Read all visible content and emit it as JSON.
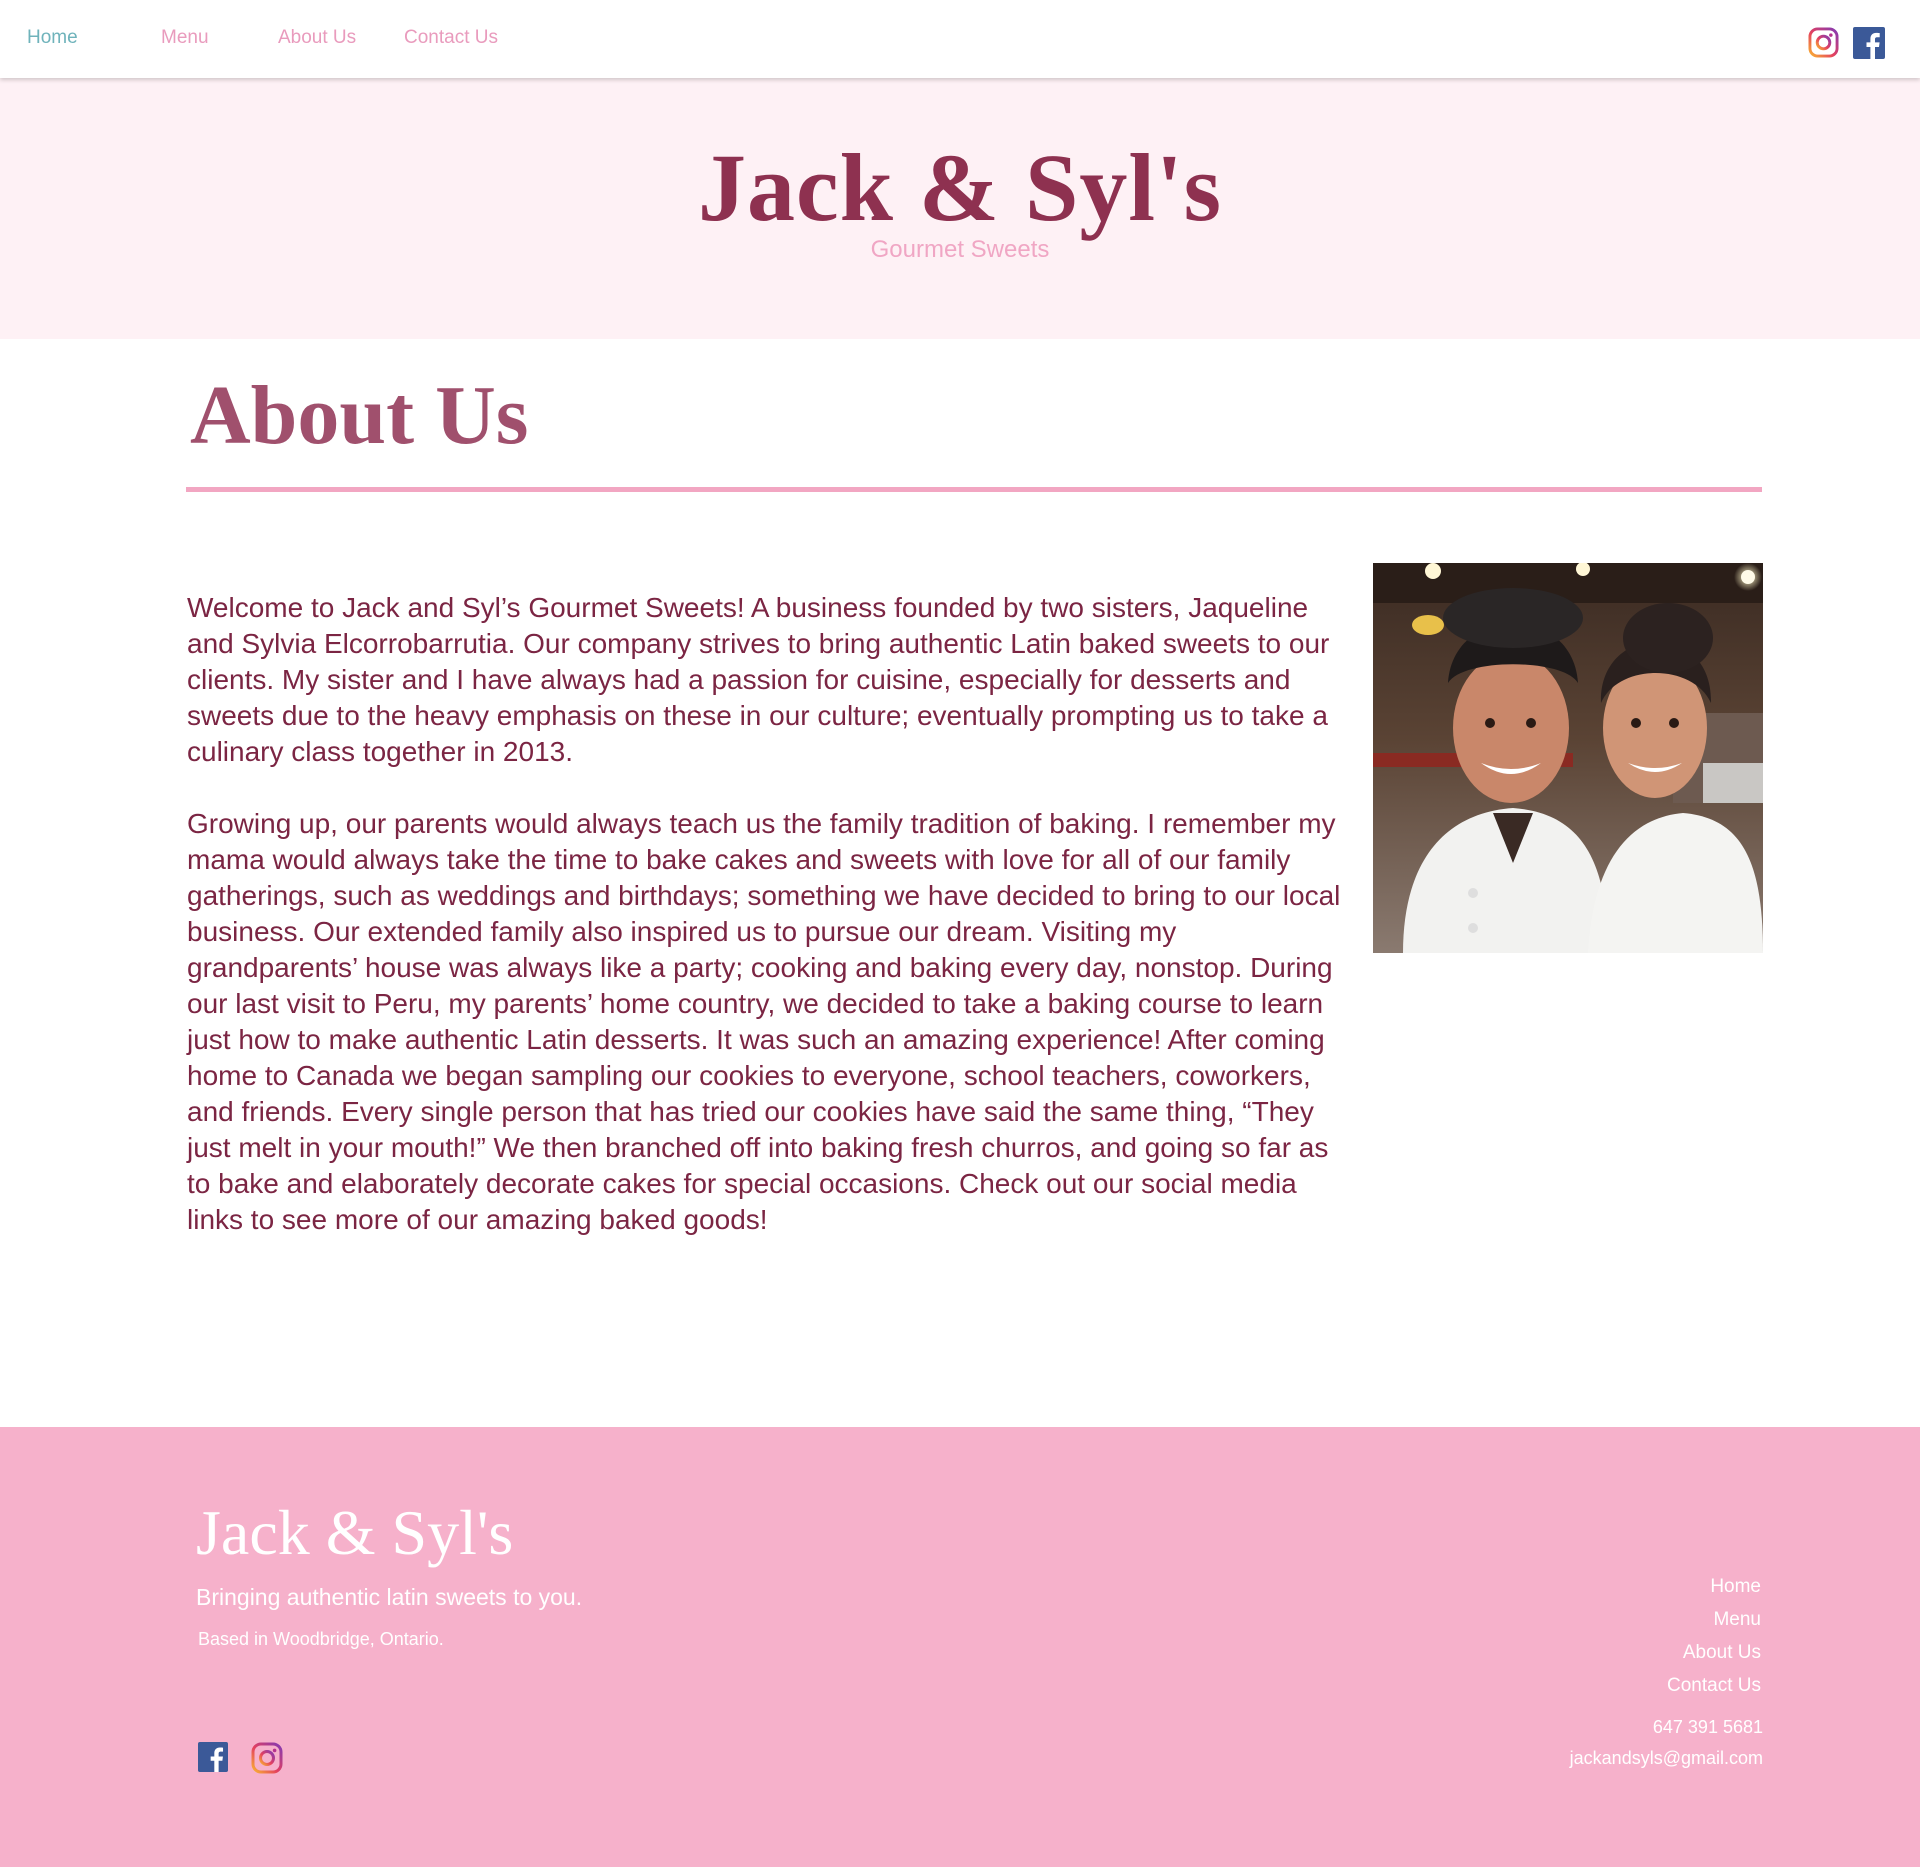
{
  "nav": {
    "items": [
      {
        "label": "Home"
      },
      {
        "label": "Menu"
      },
      {
        "label": "About Us"
      },
      {
        "label": "Contact Us"
      }
    ],
    "social": [
      "instagram-icon",
      "facebook-icon"
    ]
  },
  "hero": {
    "title": "Jack & Syl's",
    "subtitle": "Gourmet Sweets"
  },
  "about": {
    "heading": "About Us",
    "paragraphs": [
      "Welcome to Jack and Syl’s Gourmet Sweets! A business founded by two sisters, Jaqueline and Sylvia Elcorrobarrutia. Our company strives to bring authentic Latin baked sweets to our clients. My sister and I have always had a passion for cuisine, especially for desserts and sweets due to the heavy emphasis on these in our culture; eventually prompting us to take a culinary class together in 2013.",
      "Growing up, our parents would always teach us the family tradition of baking. I remember my mama would always take the time to bake cakes and sweets with love for all of our family gatherings, such as weddings and birthdays; something we have decided to bring to our local business. Our extended family also inspired us to pursue our dream. Visiting my grandparents’ house was always like a party; cooking and baking every day, nonstop. During our last visit to Peru, my parents’ home country, we decided to take a baking course to learn just how to make authentic Latin desserts. It was such an amazing experience! After coming home to Canada we began sampling our cookies to everyone, school teachers, coworkers, and friends. Every single person that has tried our cookies have said the same thing, “They just melt in your mouth!” We then branched off into baking fresh churros, and going so far as to bake and elaborately decorate cakes for special occasions. Check out our social media links to see more of our amazing baked goods!"
    ]
  },
  "footer": {
    "brand": "Jack & Syl's",
    "tagline": "Bringing authentic latin sweets to you.",
    "location": "Based in Woodbridge, Ontario.",
    "links": [
      {
        "label": "Home"
      },
      {
        "label": "Menu"
      },
      {
        "label": "About Us"
      },
      {
        "label": "Contact Us"
      }
    ],
    "phone": "647 391 5681",
    "email": "jackandsyls@gmail.com"
  },
  "colors": {
    "nav_home": "#6fb3bb",
    "nav_link": "#e99bbd",
    "brand_dark": "#8e3150",
    "hero_bg": "#fef1f5",
    "body_text": "#7b2543",
    "accent_rule": "#f2a6c2",
    "footer_bg": "#f6b1cb"
  }
}
